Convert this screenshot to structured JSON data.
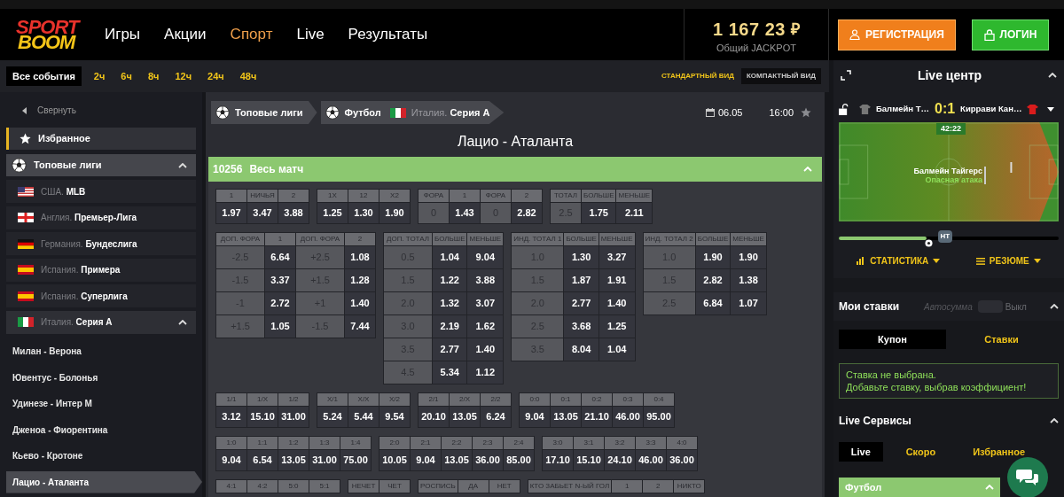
{
  "header": {
    "logo_top": "SPORT",
    "logo_bottom": "BOOM",
    "nav": [
      {
        "label": "Игры",
        "selected": false
      },
      {
        "label": "Акции",
        "selected": false
      },
      {
        "label": "Спорт",
        "selected": true
      },
      {
        "label": "Live",
        "selected": false
      },
      {
        "label": "Результаты",
        "selected": false
      }
    ],
    "jackpot": {
      "amount": "1 167 23",
      "currency": "₽",
      "label": "Общий JACKPOT"
    },
    "buttons": [
      {
        "label": "РЕГИСТРАЦИЯ",
        "kind": "register"
      },
      {
        "label": "ЛОГИН",
        "kind": "login"
      }
    ]
  },
  "time_filters": [
    {
      "label": "Все события",
      "selected": true
    },
    {
      "label": "2ч",
      "selected": false
    },
    {
      "label": "6ч",
      "selected": false
    },
    {
      "label": "8ч",
      "selected": false
    },
    {
      "label": "12ч",
      "selected": false
    },
    {
      "label": "24ч",
      "selected": false
    },
    {
      "label": "48ч",
      "selected": false
    }
  ],
  "view_modes": [
    {
      "label": "СТАНДАРТНЫЙ ВИД",
      "selected": false
    },
    {
      "label": "КОМПАКТНЫЙ ВИД",
      "selected": true
    }
  ],
  "sidebar": {
    "collapse": "Свернуть",
    "items": [
      {
        "kind": "favorites",
        "label": "Избранное"
      },
      {
        "kind": "group",
        "label": "Топовые лиги",
        "expanded": true,
        "children": [
          {
            "kind": "league",
            "flag": {
              "kind": "us"
            },
            "country": "США.",
            "league": "MLB",
            "expanded": false
          },
          {
            "kind": "league",
            "flag": {
              "kind": "en"
            },
            "country": "Англия.",
            "league": "Премьер-Лига",
            "expanded": false
          },
          {
            "kind": "league",
            "flag": {
              "kind": "de"
            },
            "country": "Германия.",
            "league": "Бундеслига",
            "expanded": false
          },
          {
            "kind": "league",
            "flag": {
              "kind": "es"
            },
            "country": "Испания.",
            "league": "Примера",
            "expanded": false
          },
          {
            "kind": "league",
            "flag": {
              "kind": "es"
            },
            "country": "Испания.",
            "league": "Суперлига",
            "expanded": false
          },
          {
            "kind": "league",
            "flag": {
              "kind": "it"
            },
            "country": "Италия.",
            "league": "Серия А",
            "expanded": true,
            "children": [
              {
                "kind": "match",
                "label": "Милан - Верона",
                "selected": false
              },
              {
                "kind": "match",
                "label": "Ювентус - Болонья",
                "selected": false
              },
              {
                "kind": "match",
                "label": "Удинезе - Интер М",
                "selected": false
              },
              {
                "kind": "match",
                "label": "Дженоа - Фиорентина",
                "selected": false
              },
              {
                "kind": "match",
                "label": "Кьево - Кротоне",
                "selected": false
              },
              {
                "kind": "match",
                "label": "Лацио - Аталанта",
                "selected": true
              }
            ]
          }
        ]
      }
    ]
  },
  "event": {
    "breadcrumbs": [
      {
        "label": "Топовые лиги"
      },
      {
        "label": "Футбол",
        "flag": {
          "kind": "it"
        },
        "country": "Италия.",
        "league": "Серия А"
      }
    ],
    "date": "06.05",
    "time": "16:00",
    "favorite": false,
    "title": "Лацио - Аталанта",
    "market_group": {
      "id": "10256",
      "label": "Весь матч",
      "expanded": true
    },
    "market_lines": [
      [
        {
          "columns": [
            {
              "label": "1",
              "kind": "odd"
            },
            {
              "label": "НИЧЬЯ",
              "kind": "odd"
            },
            {
              "label": "2",
              "kind": "odd"
            }
          ],
          "rows": [
            [
              "1.97",
              "3.47",
              "3.88"
            ]
          ]
        },
        {
          "columns": [
            {
              "label": "1X",
              "kind": "odd"
            },
            {
              "label": "12",
              "kind": "odd"
            },
            {
              "label": "X2",
              "kind": "odd"
            }
          ],
          "rows": [
            [
              "1.25",
              "1.30",
              "1.90"
            ]
          ]
        },
        {
          "columns": [
            {
              "label": "ФОРА",
              "kind": "param"
            },
            {
              "label": "1",
              "kind": "odd"
            },
            {
              "label": "ФОРА",
              "kind": "param"
            },
            {
              "label": "2",
              "kind": "odd"
            }
          ],
          "rows": [
            [
              "0",
              "1.43",
              "0",
              "2.82"
            ]
          ]
        },
        {
          "columns": [
            {
              "label": "ТОТАЛ",
              "kind": "param"
            },
            {
              "label": "БОЛЬШЕ",
              "kind": "odd"
            },
            {
              "label": "МЕНЬШЕ",
              "kind": "odd"
            }
          ],
          "rows": [
            [
              "2.5",
              "1.75",
              "2.11"
            ]
          ]
        }
      ],
      [
        {
          "columns": [
            {
              "label": "ДОП. ФОРА",
              "kind": "param"
            },
            {
              "label": "1",
              "kind": "odd"
            },
            {
              "label": "ДОП. ФОРА",
              "kind": "param"
            },
            {
              "label": "2",
              "kind": "odd"
            }
          ],
          "rows": [
            [
              "-2.5",
              "6.64",
              "+2.5",
              "1.08"
            ],
            [
              "-1.5",
              "3.37",
              "+1.5",
              "1.28"
            ],
            [
              "-1",
              "2.72",
              "+1",
              "1.40"
            ],
            [
              "+1.5",
              "1.05",
              "-1.5",
              "7.44"
            ]
          ]
        },
        {
          "columns": [
            {
              "label": "ДОП. ТОТАЛ",
              "kind": "param"
            },
            {
              "label": "БОЛЬШЕ",
              "kind": "odd"
            },
            {
              "label": "МЕНЬШЕ",
              "kind": "odd"
            }
          ],
          "rows": [
            [
              "0.5",
              "1.04",
              "9.04"
            ],
            [
              "1.5",
              "1.22",
              "3.88"
            ],
            [
              "2.0",
              "1.32",
              "3.07"
            ],
            [
              "3.0",
              "2.19",
              "1.62"
            ],
            [
              "3.5",
              "2.77",
              "1.40"
            ],
            [
              "4.5",
              "5.34",
              "1.12"
            ]
          ]
        },
        {
          "columns": [
            {
              "label": "ИНД. ТОТАЛ 1",
              "kind": "param"
            },
            {
              "label": "БОЛЬШЕ",
              "kind": "odd"
            },
            {
              "label": "МЕНЬШЕ",
              "kind": "odd"
            }
          ],
          "rows": [
            [
              "1.0",
              "1.30",
              "3.27"
            ],
            [
              "1.5",
              "1.87",
              "1.91"
            ],
            [
              "2.0",
              "2.77",
              "1.40"
            ],
            [
              "2.5",
              "3.68",
              "1.25"
            ],
            [
              "3.5",
              "8.04",
              "1.04"
            ]
          ]
        },
        {
          "columns": [
            {
              "label": "ИНД. ТОТАЛ 2",
              "kind": "param"
            },
            {
              "label": "БОЛЬШЕ",
              "kind": "odd"
            },
            {
              "label": "МЕНЬШЕ",
              "kind": "odd"
            }
          ],
          "rows": [
            [
              "1.0",
              "1.90",
              "1.90"
            ],
            [
              "1.5",
              "2.82",
              "1.38"
            ],
            [
              "2.5",
              "6.84",
              "1.07"
            ]
          ]
        }
      ],
      [
        {
          "columns": [
            {
              "label": "1/1",
              "kind": "odd"
            },
            {
              "label": "1/X",
              "kind": "odd"
            },
            {
              "label": "1/2",
              "kind": "odd"
            }
          ],
          "rows": [
            [
              "3.12",
              "15.10",
              "31.00"
            ]
          ]
        },
        {
          "columns": [
            {
              "label": "X/1",
              "kind": "odd"
            },
            {
              "label": "X/X",
              "kind": "odd"
            },
            {
              "label": "X/2",
              "kind": "odd"
            }
          ],
          "rows": [
            [
              "5.24",
              "5.44",
              "9.54"
            ]
          ]
        },
        {
          "columns": [
            {
              "label": "2/1",
              "kind": "odd"
            },
            {
              "label": "2/X",
              "kind": "odd"
            },
            {
              "label": "2/2",
              "kind": "odd"
            }
          ],
          "rows": [
            [
              "20.10",
              "13.05",
              "6.24"
            ]
          ]
        },
        {
          "columns": [
            {
              "label": "0:0",
              "kind": "odd"
            },
            {
              "label": "0:1",
              "kind": "odd"
            },
            {
              "label": "0:2",
              "kind": "odd"
            },
            {
              "label": "0:3",
              "kind": "odd"
            },
            {
              "label": "0:4",
              "kind": "odd"
            }
          ],
          "rows": [
            [
              "9.04",
              "13.05",
              "21.10",
              "46.00",
              "95.00"
            ]
          ]
        }
      ],
      [
        {
          "columns": [
            {
              "label": "1:0",
              "kind": "odd"
            },
            {
              "label": "1:1",
              "kind": "odd"
            },
            {
              "label": "1:2",
              "kind": "odd"
            },
            {
              "label": "1:3",
              "kind": "odd"
            },
            {
              "label": "1:4",
              "kind": "odd"
            }
          ],
          "rows": [
            [
              "9.04",
              "6.54",
              "13.05",
              "31.00",
              "75.00"
            ]
          ]
        },
        {
          "columns": [
            {
              "label": "2:0",
              "kind": "odd"
            },
            {
              "label": "2:1",
              "kind": "odd"
            },
            {
              "label": "2:2",
              "kind": "odd"
            },
            {
              "label": "2:3",
              "kind": "odd"
            },
            {
              "label": "2:4",
              "kind": "odd"
            }
          ],
          "rows": [
            [
              "10.05",
              "9.04",
              "13.05",
              "36.00",
              "85.00"
            ]
          ]
        },
        {
          "columns": [
            {
              "label": "3:0",
              "kind": "odd"
            },
            {
              "label": "3:1",
              "kind": "odd"
            },
            {
              "label": "3:2",
              "kind": "odd"
            },
            {
              "label": "3:3",
              "kind": "odd"
            },
            {
              "label": "4:0",
              "kind": "odd"
            }
          ],
          "rows": [
            [
              "17.10",
              "15.10",
              "24.10",
              "46.00",
              "36.00"
            ]
          ]
        }
      ],
      [
        {
          "columns": [
            {
              "label": "4:1",
              "kind": "odd"
            },
            {
              "label": "4:2",
              "kind": "odd"
            },
            {
              "label": "5:0",
              "kind": "odd"
            },
            {
              "label": "5:1",
              "kind": "odd"
            }
          ]
        },
        {
          "columns": [
            {
              "label": "НЕЧЕТ",
              "kind": "odd"
            },
            {
              "label": "ЧЕТ",
              "kind": "odd"
            }
          ]
        },
        {
          "columns": [
            {
              "label": "РОСПИСЬ",
              "kind": "param"
            },
            {
              "label": "ДА",
              "kind": "odd"
            },
            {
              "label": "НЕТ",
              "kind": "odd"
            }
          ]
        },
        {
          "columns": [
            {
              "label": "КТО ЗАБЬЕТ N-ЫЙ ГОЛ",
              "kind": "param"
            },
            {
              "label": "1",
              "kind": "odd"
            },
            {
              "label": "2",
              "kind": "odd"
            },
            {
              "label": "НИКТО",
              "kind": "odd"
            }
          ]
        }
      ]
    ]
  },
  "live_center": {
    "title": "Live центр",
    "expanded": true,
    "home": "Балмейн Т…",
    "score": "0:1",
    "away": "Киррави Кан…",
    "clock": "42:22",
    "attacking_team": "Балмейн Тайгерс",
    "event": "Опасная атака",
    "timeline": {
      "level": 0.4,
      "marker": "HT"
    },
    "tabs": [
      {
        "label": "СТАТИСТИКА",
        "kind": "stats"
      },
      {
        "label": "РЕЗЮМЕ",
        "kind": "summary"
      }
    ]
  },
  "my_bets": {
    "title": "Мои ставки",
    "expanded": true,
    "autosum": {
      "label": "Автосумма",
      "on": false,
      "state_label": "Выкл"
    },
    "tabs": [
      {
        "label": "Купон",
        "selected": true
      },
      {
        "label": "Ставки",
        "selected": false
      }
    ],
    "message": [
      "Ставка не выбрана.",
      "Добавьте ставку, выбрав коэффициент!"
    ]
  },
  "live_services": {
    "title": "Live Сервисы",
    "expanded": true,
    "tabs": [
      {
        "label": "Live",
        "selected": true
      },
      {
        "label": "Скоро",
        "selected": false
      },
      {
        "label": "Избранное",
        "selected": false
      }
    ],
    "sport": {
      "label": "Футбол",
      "expanded": true
    }
  }
}
